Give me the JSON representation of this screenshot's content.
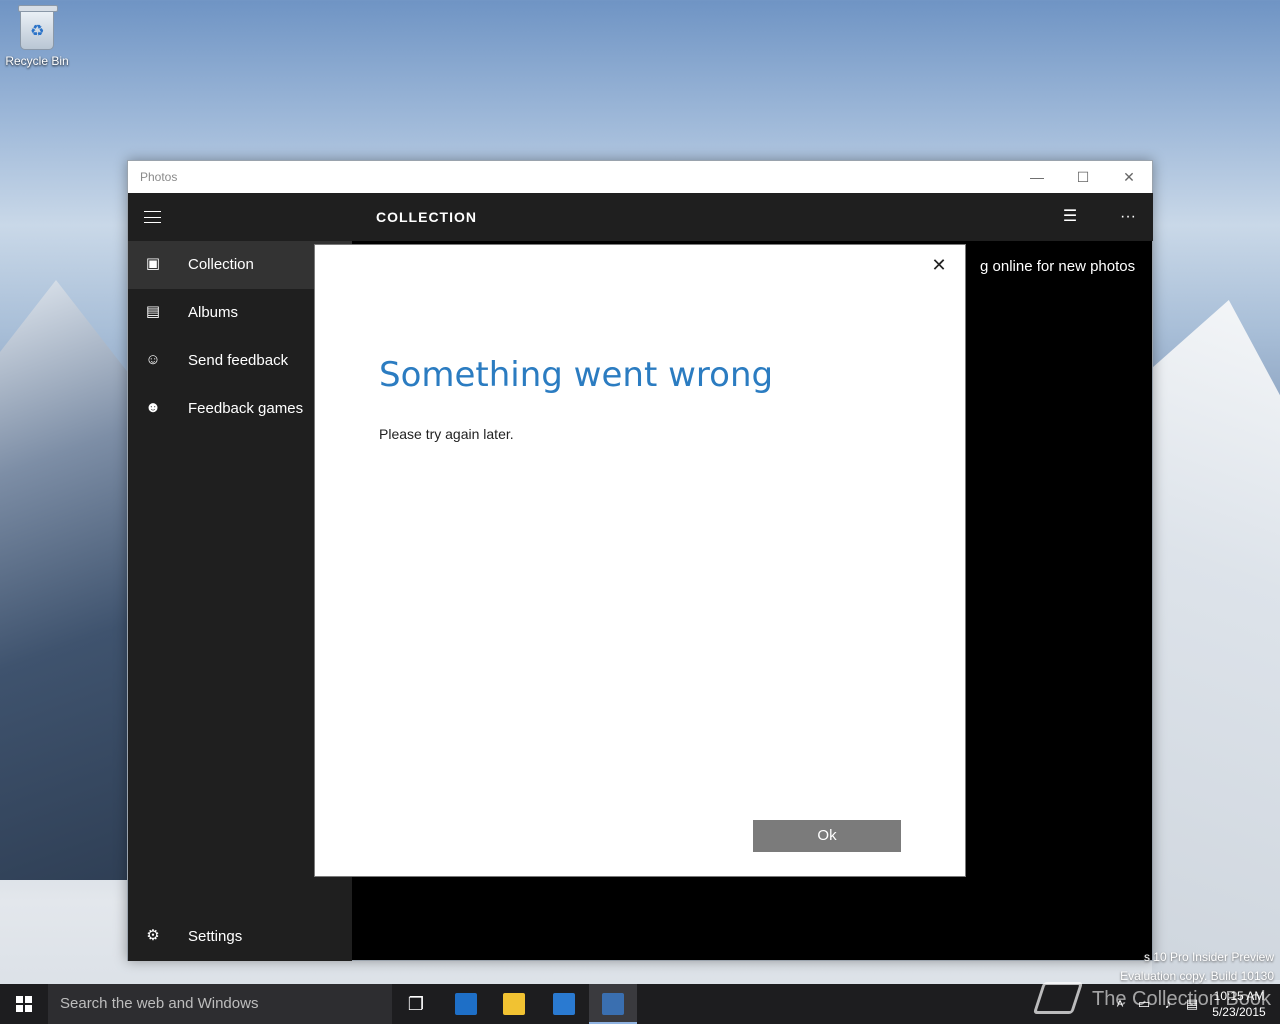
{
  "desktop": {
    "recycle_bin_label": "Recycle Bin",
    "watermark_line1": "s 10 Pro Insider Preview",
    "watermark_line2": "Evaluation copy. Build 10130",
    "overlay_logo_text": "The Collection Book"
  },
  "window": {
    "title": "Photos",
    "minimize": "—",
    "maximize": "☐",
    "close": "✕"
  },
  "sidebar": {
    "items": [
      {
        "label": "Collection",
        "icon": "collection-icon"
      },
      {
        "label": "Albums",
        "icon": "albums-icon"
      },
      {
        "label": "Send feedback",
        "icon": "feedback-icon"
      },
      {
        "label": "Feedback games",
        "icon": "feedback-games-icon"
      }
    ],
    "settings_label": "Settings"
  },
  "header": {
    "title": "COLLECTION",
    "select_icon": "☰",
    "more_icon": "···"
  },
  "behind_dialog_text": "g online for new photos",
  "dialog": {
    "title": "Something went wrong",
    "message": "Please try again later.",
    "ok_label": "Ok",
    "close_glyph": "✕"
  },
  "taskbar": {
    "search_placeholder": "Search the web and Windows",
    "time": "10:15 AM",
    "date": "5/23/2015"
  },
  "colors": {
    "accent_blue": "#2b7cc1",
    "sidebar_bg": "#1f1f1f",
    "selected_item_bg": "#333333",
    "ok_button_bg": "#7b7b7b",
    "taskbar_bg": "#1d1d1f"
  }
}
